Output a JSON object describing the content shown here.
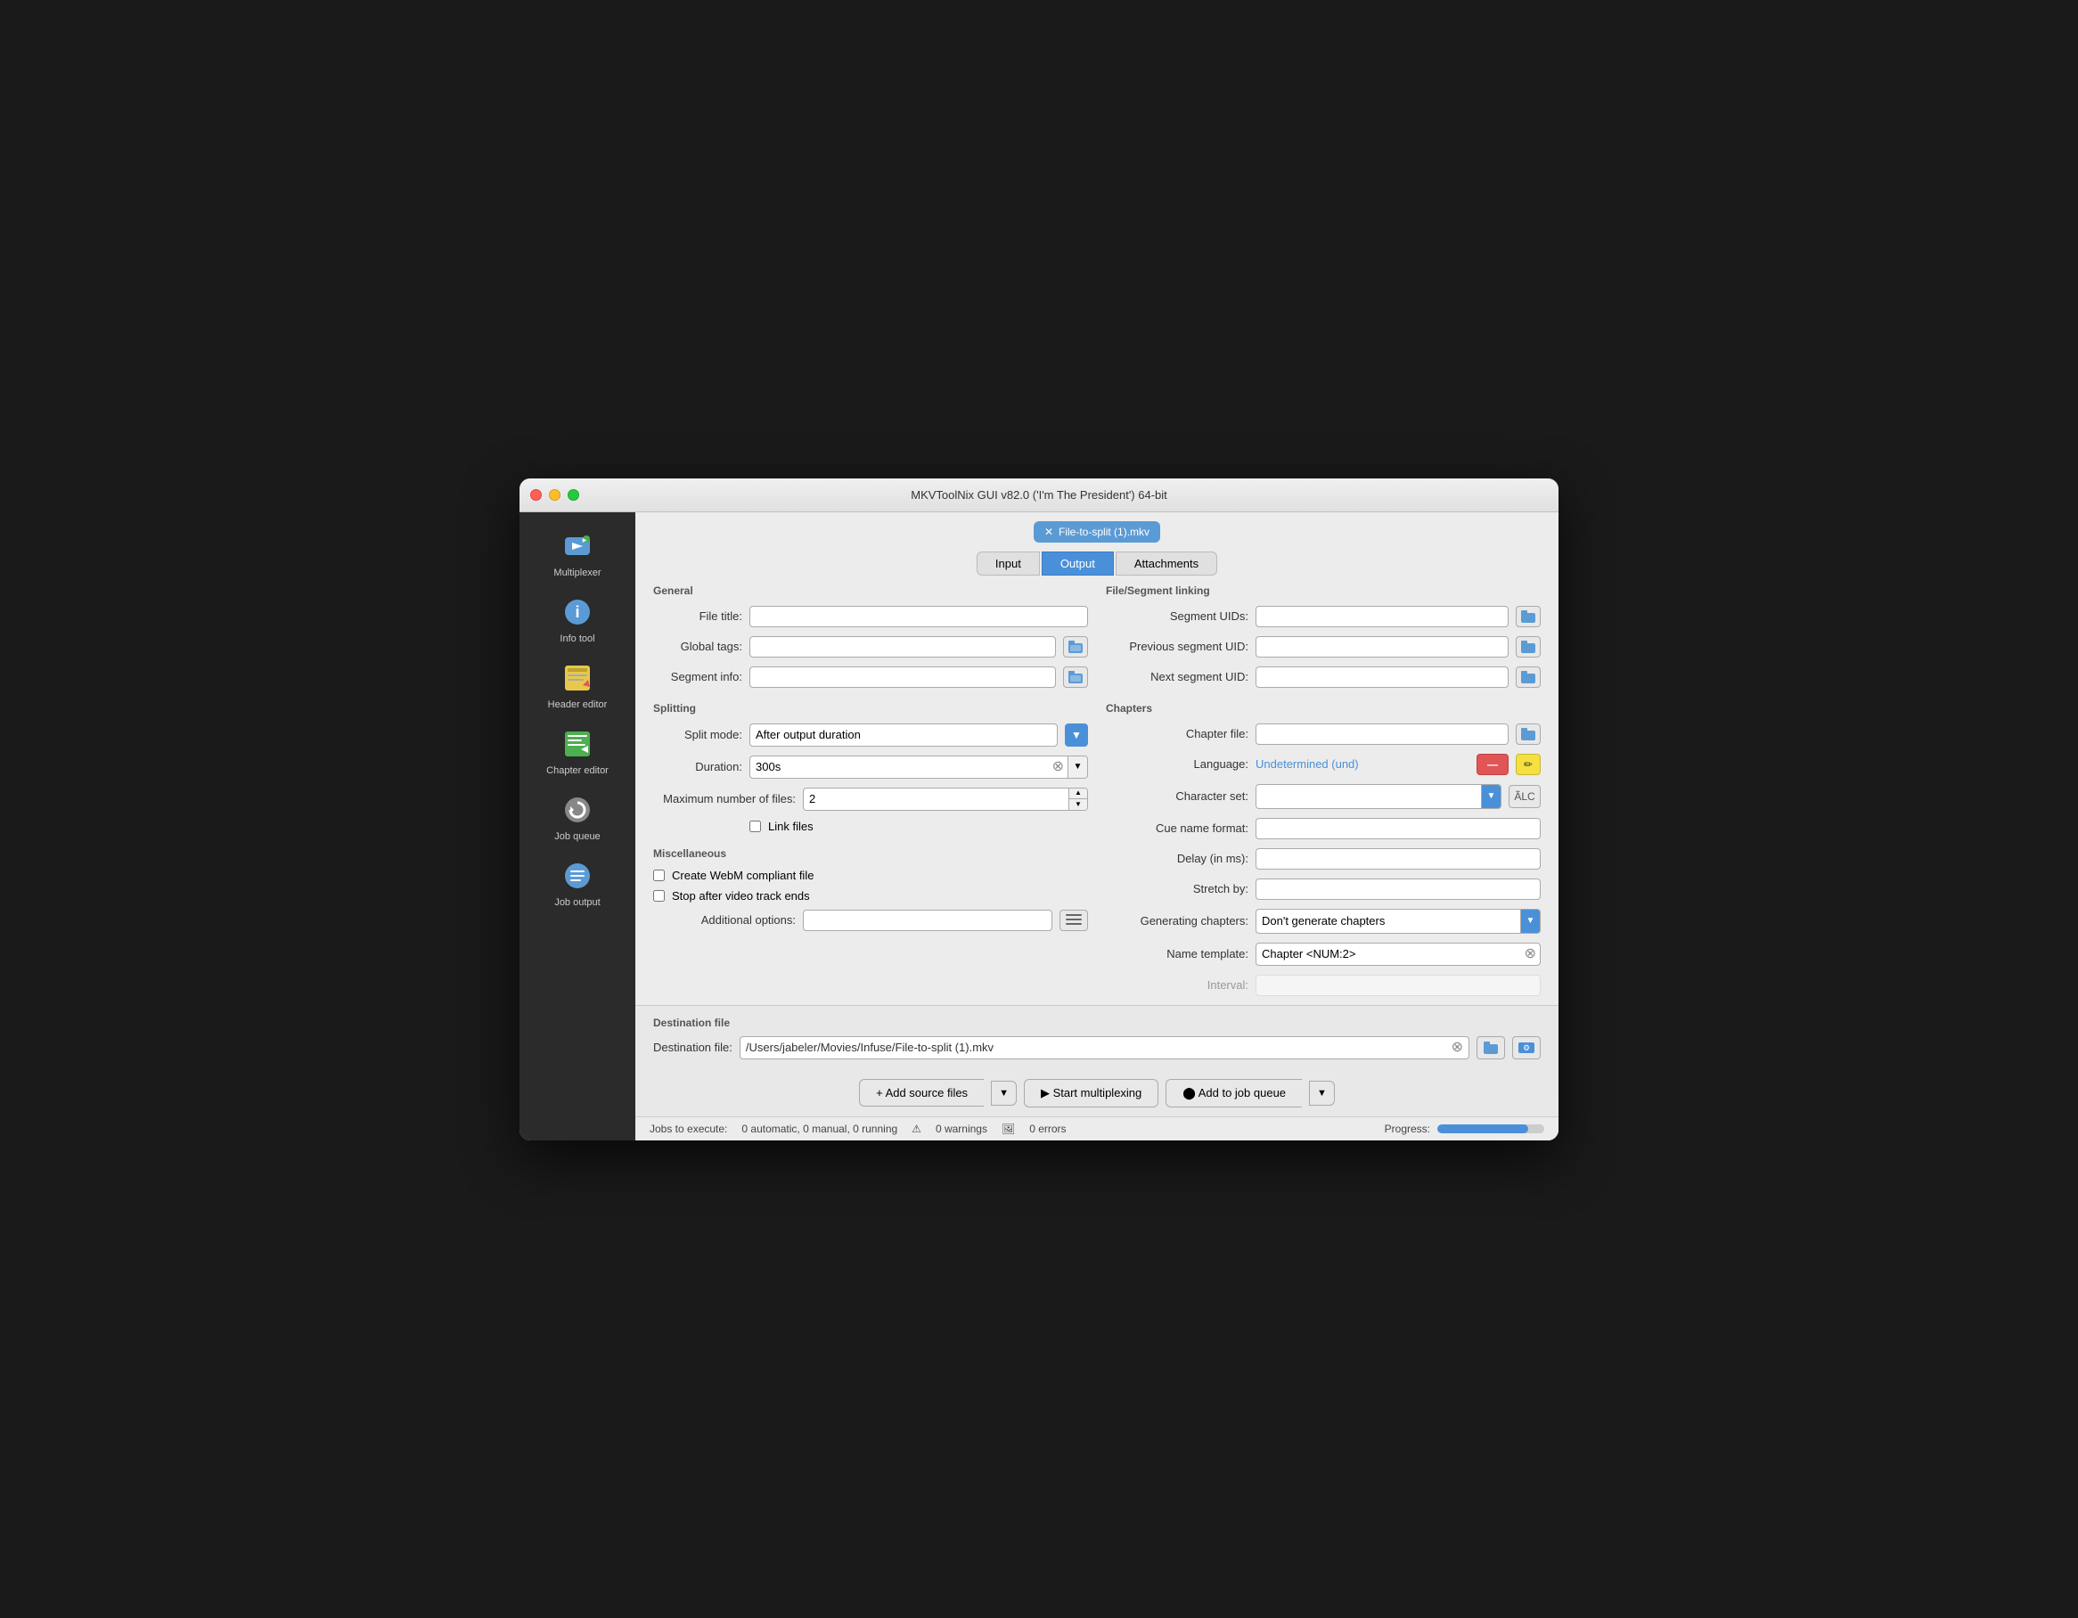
{
  "window": {
    "title": "MKVToolNix GUI v82.0 ('I'm The President') 64-bit"
  },
  "sidebar": {
    "items": [
      {
        "id": "multiplexer",
        "label": "Multiplexer",
        "icon": "multiplexer-icon"
      },
      {
        "id": "info-tool",
        "label": "Info tool",
        "icon": "info-icon"
      },
      {
        "id": "header-editor",
        "label": "Header editor",
        "icon": "header-icon"
      },
      {
        "id": "chapter-editor",
        "label": "Chapter editor",
        "icon": "chapter-icon"
      },
      {
        "id": "job-queue",
        "label": "Job queue",
        "icon": "jobqueue-icon"
      },
      {
        "id": "job-output",
        "label": "Job output",
        "icon": "joboutput-icon"
      }
    ]
  },
  "file_chip": {
    "label": "File-to-split (1).mkv",
    "close": "✕"
  },
  "tabs": {
    "items": [
      "Input",
      "Output",
      "Attachments"
    ],
    "active": "Output"
  },
  "general": {
    "title": "General",
    "file_title_label": "File title:",
    "file_title_value": "",
    "global_tags_label": "Global tags:",
    "global_tags_value": "",
    "segment_info_label": "Segment info:",
    "segment_info_value": ""
  },
  "splitting": {
    "title": "Splitting",
    "split_mode_label": "Split mode:",
    "split_mode_value": "After output duration",
    "duration_label": "Duration:",
    "duration_value": "300s",
    "max_files_label": "Maximum number of files:",
    "max_files_value": "2",
    "link_files_label": "Link files"
  },
  "miscellaneous": {
    "title": "Miscellaneous",
    "create_webm_label": "Create WebM compliant file",
    "stop_after_video_label": "Stop after video track ends",
    "additional_options_label": "Additional options:",
    "additional_options_value": ""
  },
  "file_segment_linking": {
    "title": "File/Segment linking",
    "segment_uids_label": "Segment UIDs:",
    "segment_uids_value": "",
    "prev_segment_uid_label": "Previous segment UID:",
    "prev_segment_uid_value": "",
    "next_segment_uid_label": "Next segment UID:",
    "next_segment_uid_value": ""
  },
  "chapters": {
    "title": "Chapters",
    "chapter_file_label": "Chapter file:",
    "chapter_file_value": "",
    "language_label": "Language:",
    "language_value": "Undetermined (und)",
    "character_set_label": "Character set:",
    "character_set_value": "",
    "alc_label": "ÃLC",
    "cue_name_format_label": "Cue name format:",
    "cue_name_format_value": "",
    "delay_label": "Delay (in ms):",
    "delay_value": "",
    "stretch_by_label": "Stretch by:",
    "stretch_by_value": "",
    "generating_chapters_label": "Generating chapters:",
    "generating_chapters_value": "Don't generate chapters",
    "name_template_label": "Name template:",
    "name_template_value": "Chapter <NUM:2>",
    "interval_label": "Interval:",
    "interval_value": ""
  },
  "destination": {
    "title": "Destination file",
    "dest_label": "Destination file:",
    "dest_path": "/Users/jabeler/Movies/Infuse/File-to-split (1).mkv"
  },
  "actions": {
    "add_source": "+ Add source files",
    "start_mux": "▶ Start multiplexing",
    "add_queue": "⬤ Add to job queue"
  },
  "status_bar": {
    "jobs_label": "Jobs to execute:",
    "jobs_value": "0 automatic, 0 manual, 0 running",
    "warnings_value": "0 warnings",
    "errors_value": "0 errors",
    "progress_label": "Progress:",
    "progress_percent": 85
  }
}
